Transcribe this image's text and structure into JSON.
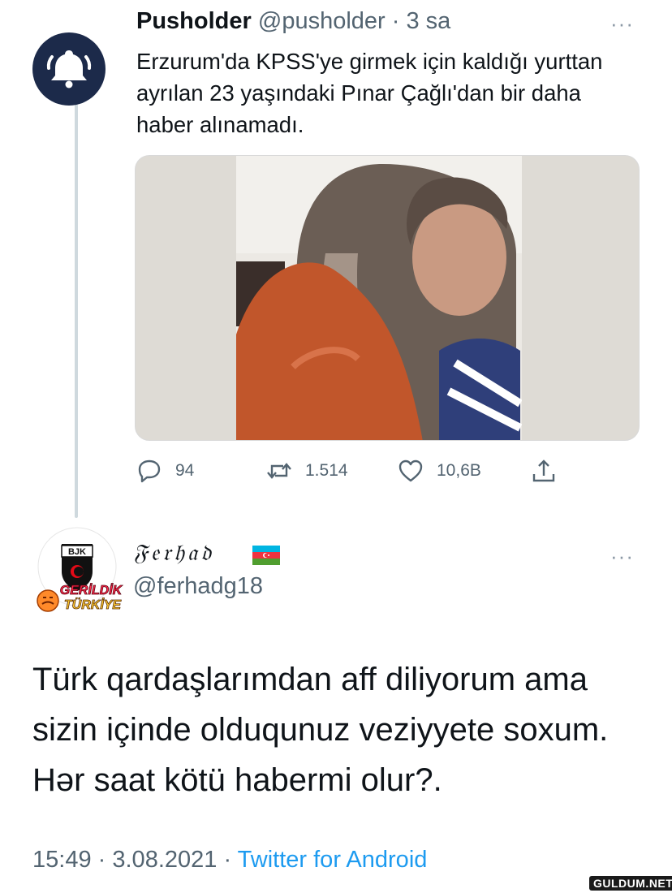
{
  "tweet1": {
    "name": "Pusholder",
    "handle": "@pusholder",
    "separator": "·",
    "time": "3 sa",
    "more": "···",
    "text": "Erzurum'da KPSS'ye girmek için kaldığı yurttan ayrılan 23 yaşındaki Pınar Çağlı'dan bir daha haber alınamadı.",
    "avatar_icon": "bell-icon",
    "avatar_color": "#1c2a4a",
    "actions": {
      "reply_count": "94",
      "retweet_count": "1.514",
      "like_count": "10,6B"
    }
  },
  "tweet2": {
    "name": "𝔉𝔢𝔯𝔥𝔞𝔡",
    "handle": "@ferhadg18",
    "more": "···",
    "flag_icon": "azerbaijan-flag-icon",
    "avatar_badge_line1": "GERİLDİK",
    "avatar_badge_line2": "TÜRKİYE",
    "avatar_logo_text": "BJK",
    "text": "Türk qardaşlarımdan aff diliyorum ama sizin içinde olduqunuz veziyyete soxum. Hər saat kötü habermi olur?.",
    "time": "15:49",
    "date": "3.08.2021",
    "separator": "·",
    "source": "Twitter for Android"
  },
  "watermark": "GULDUM.NET",
  "colors": {
    "text": "#0f1419",
    "secondary": "#536471",
    "link": "#1d9bf0",
    "thread_line": "#cfd9de"
  }
}
